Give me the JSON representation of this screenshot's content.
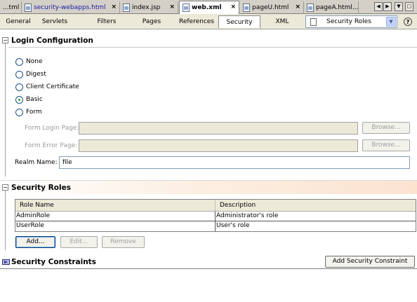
{
  "editor_tabs": [
    {
      "label": "...tml",
      "close": "",
      "icon": false,
      "link": false,
      "active": false
    },
    {
      "label": "security-webapps.html",
      "close": "×",
      "icon": true,
      "link": true,
      "active": false
    },
    {
      "label": "index.jsp",
      "close": "×",
      "icon": true,
      "link": false,
      "active": false
    },
    {
      "label": "web.xml",
      "close": "×",
      "icon": true,
      "link": false,
      "active": true
    },
    {
      "label": "pageU.html",
      "close": "×",
      "icon": true,
      "link": false,
      "active": false
    },
    {
      "label": "pageA.html...",
      "close": "",
      "icon": true,
      "link": false,
      "active": false
    }
  ],
  "view_tabs": [
    "General",
    "Servlets",
    "Filters",
    "Pages",
    "References",
    "Security",
    "XML"
  ],
  "active_view_tab": "Security",
  "view_combo": {
    "value": "Security Roles"
  },
  "help_label": "?",
  "login": {
    "title": "Login Configuration",
    "options": [
      "None",
      "Digest",
      "Client Certificate",
      "Basic",
      "Form"
    ],
    "selected": "Basic",
    "form_login_label": "Form Login Page:",
    "form_error_label": "Form Error Page:",
    "browse_label": "Browse...",
    "realm_label": "Realm Name:",
    "realm_value": "file"
  },
  "roles": {
    "title": "Security Roles",
    "columns": [
      "Role Name",
      "Description"
    ],
    "rows": [
      [
        "AdminRole",
        "Administrator's role"
      ],
      [
        "UserRole",
        "User's role"
      ]
    ],
    "add_label": "Add...",
    "edit_label": "Edit...",
    "remove_label": "Remove"
  },
  "constraints": {
    "title": "Security Constraints",
    "add_label": "Add Security Constraint"
  },
  "expander_symbol": "−",
  "colors": {
    "accent": "#1a1aa8",
    "radio_checked": "#21a121",
    "section_tint": "#fbe3d0"
  }
}
